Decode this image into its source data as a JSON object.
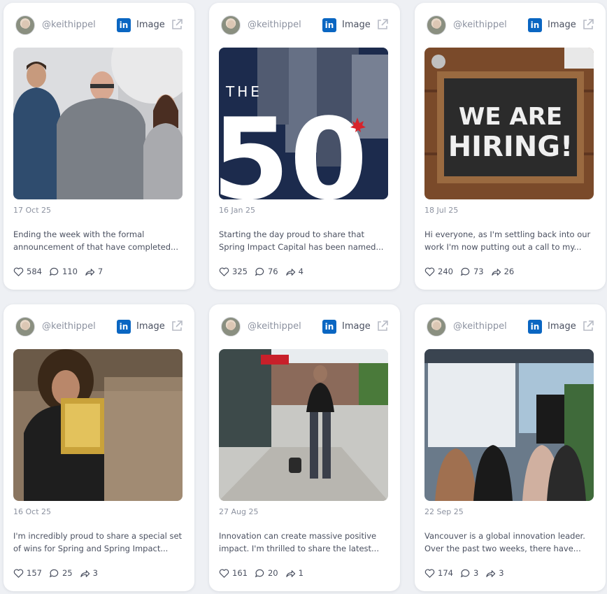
{
  "posts": [
    {
      "handle": "@keithippel",
      "type": "Image",
      "date": "17 Oct 25",
      "text": "Ending the week with the formal announcement of that have completed...",
      "likes": "584",
      "comments": "110",
      "shares": "7"
    },
    {
      "handle": "@keithippel",
      "type": "Image",
      "date": "16 Jan 25",
      "text": "Starting the day proud to share that Spring Impact Capital has been named...",
      "likes": "325",
      "comments": "76",
      "shares": "4",
      "image_text": {
        "the": "THE",
        "fifty": "50"
      }
    },
    {
      "handle": "@keithippel",
      "type": "Image",
      "date": "18 Jul 25",
      "text": "Hi everyone, as I'm settling back into our work I'm now putting out a call to my...",
      "likes": "240",
      "comments": "73",
      "shares": "26",
      "image_text": {
        "line1": "WE ARE",
        "line2": "HIRING!"
      }
    },
    {
      "handle": "@keithippel",
      "type": "Image",
      "date": "16 Oct 25",
      "text": "I'm incredibly proud to share a special set of wins for Spring and Spring Impact...",
      "likes": "157",
      "comments": "25",
      "shares": "3"
    },
    {
      "handle": "@keithippel",
      "type": "Image",
      "date": "27 Aug 25",
      "text": "Innovation can create massive positive impact. I'm thrilled to share the latest...",
      "likes": "161",
      "comments": "20",
      "shares": "1"
    },
    {
      "handle": "@keithippel",
      "type": "Image",
      "date": "22 Sep 25",
      "text": "Vancouver is a global innovation leader. Over the past two weeks, there have...",
      "likes": "174",
      "comments": "3",
      "shares": "3"
    }
  ],
  "colors": {
    "linkedin": "#0a66c2",
    "background": "#eef0f4",
    "card": "#ffffff",
    "muted": "#8c92a0"
  },
  "icons": {
    "network": "linkedin-icon",
    "open": "external-link-icon",
    "like": "heart-icon",
    "comment": "comment-icon",
    "share": "share-icon"
  }
}
